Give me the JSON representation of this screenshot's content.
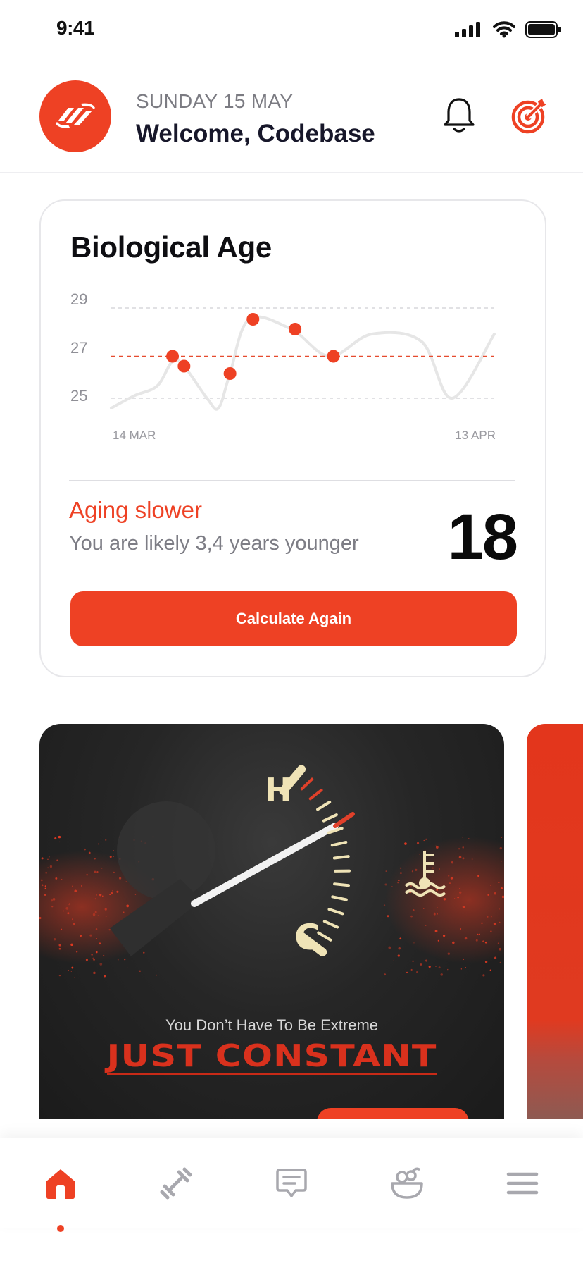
{
  "status_bar": {
    "time": "9:41"
  },
  "header": {
    "date": "SUNDAY 15 MAY",
    "welcome": "Welcome, Codebase"
  },
  "bio_card": {
    "title": "Biological Age",
    "status_label": "Aging slower",
    "status_desc": "You are likely 3,4 years younger",
    "age_value": "18",
    "button_label": "Calculate Again"
  },
  "chart_data": {
    "type": "line",
    "y_ticks": [
      "29",
      "27",
      "25"
    ],
    "ylim": [
      24.6,
      29
    ],
    "x_labels": [
      "14 MAR",
      "13 APR"
    ],
    "reference_line": 26.7,
    "line": [
      {
        "x": 0.0,
        "y": 24.6
      },
      {
        "x": 0.06,
        "y": 25.1
      },
      {
        "x": 0.12,
        "y": 25.5
      },
      {
        "x": 0.16,
        "y": 26.5
      },
      {
        "x": 0.19,
        "y": 26.3
      },
      {
        "x": 0.25,
        "y": 25.0
      },
      {
        "x": 0.28,
        "y": 24.6
      },
      {
        "x": 0.31,
        "y": 26.0
      },
      {
        "x": 0.36,
        "y": 28.2
      },
      {
        "x": 0.47,
        "y": 27.8
      },
      {
        "x": 0.57,
        "y": 26.7
      },
      {
        "x": 0.68,
        "y": 27.6
      },
      {
        "x": 0.81,
        "y": 27.3
      },
      {
        "x": 0.89,
        "y": 25.0
      },
      {
        "x": 1.0,
        "y": 27.6
      }
    ],
    "points": [
      {
        "x": 0.16,
        "y": 26.7
      },
      {
        "x": 0.19,
        "y": 26.3
      },
      {
        "x": 0.31,
        "y": 26.0
      },
      {
        "x": 0.37,
        "y": 28.2
      },
      {
        "x": 0.48,
        "y": 27.8
      },
      {
        "x": 0.58,
        "y": 26.7
      }
    ],
    "colors": {
      "line": "#e6e6e6",
      "point": "#ee4124",
      "ref": "#e64b2f",
      "grid": "#d7d7dc"
    }
  },
  "promo": {
    "subtitle": "You Don’t Have To Be Extreme",
    "title": "JUST CONSTANT",
    "gauge_hot": "H",
    "gauge_cold": "C"
  },
  "nav": {
    "items": [
      {
        "icon": "home-icon",
        "active": true
      },
      {
        "icon": "dumbbell-icon",
        "active": false
      },
      {
        "icon": "chat-icon",
        "active": false
      },
      {
        "icon": "food-bowl-icon",
        "active": false
      },
      {
        "icon": "menu-icon",
        "active": false
      }
    ]
  },
  "colors": {
    "accent": "#ee4124",
    "inactive": "#a8a8ae"
  }
}
